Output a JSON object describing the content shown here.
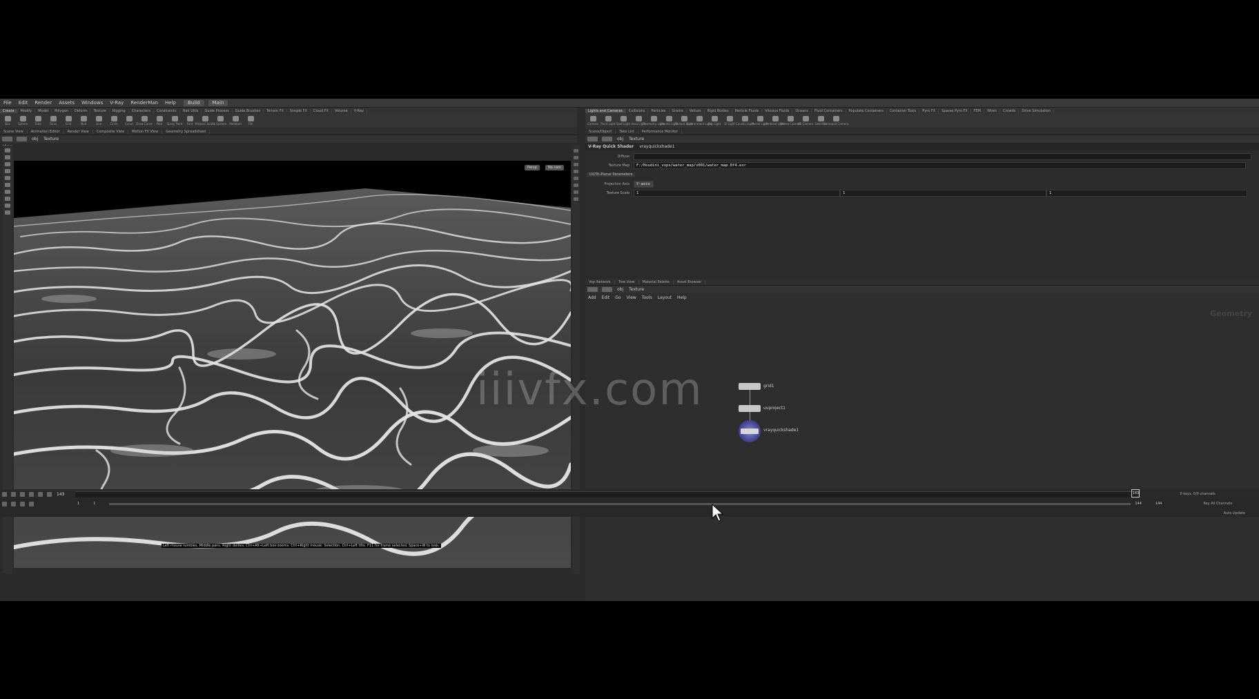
{
  "menu": {
    "items": [
      "File",
      "Edit",
      "Render",
      "Assets",
      "Windows",
      "V-Ray",
      "RenderMan",
      "Help"
    ],
    "desktop": "Build",
    "context": "Main"
  },
  "shelf_left": {
    "tabs": [
      "Create",
      "Modify",
      "Model",
      "Polygon",
      "Deform",
      "Texture",
      "Rigging",
      "Characters",
      "Constraints",
      "Hair Utils",
      "Guide Process",
      "Guide Brushes",
      "Terrain FX",
      "Simple FX",
      "Cloud FX",
      "Volume",
      "V-Ray"
    ],
    "tools": [
      "Box",
      "Sphere",
      "Tube",
      "Torus",
      "Grid",
      "Null",
      "Line",
      "Circle",
      "Curve",
      "Draw Curve",
      "Path",
      "Spray Paint",
      "Font",
      "Platonic Solids",
      "L-System",
      "Metaball",
      "File"
    ]
  },
  "shelf_right": {
    "tabs": [
      "Lights and Cameras",
      "Collisions",
      "Particles",
      "Grains",
      "Vellum",
      "Rigid Bodies",
      "Particle Fluids",
      "Viscous Fluids",
      "Oceans",
      "Fluid Containers",
      "Populate Containers",
      "Container Tools",
      "Pyro FX",
      "Sparse Pyro FX",
      "FEM",
      "Wires",
      "Crowds",
      "Drive Simulation"
    ],
    "tools": [
      "Camera",
      "Point Light",
      "Spot Light",
      "Area Light",
      "Geometry Light",
      "Volume Light",
      "Distant Light",
      "Environment Light",
      "Sky Light",
      "GI Light",
      "Caustic Light",
      "Portal Light",
      "Ambient Light",
      "Stereo Camera",
      "VR Camera",
      "Switcher",
      "Gamepad Camera"
    ]
  },
  "left_pane": {
    "tabs": [
      "Scene View",
      "Animation Editor",
      "Render View",
      "Composite View",
      "Motion FX View",
      "Geometry Spreadsheet"
    ],
    "path": "obj",
    "node": "Texture",
    "view_label": "View",
    "persp": "Persp",
    "cam": "No cam",
    "status": "Left mouse tumbles. Middle pans. Right dollies. Ctrl+Alt+Left box-zooms. Ctrl+Right mouse: Selection. Ctrl+Left tilts. F11 for frame selected. Space+W to look."
  },
  "param_pane": {
    "tabs": [
      "Scene/Object",
      "Take List",
      "Performance Monitor"
    ],
    "path": "obj",
    "node": "Texture",
    "type_label": "V-Ray Quick Shader",
    "node_name": "vrayquickshade1",
    "params": {
      "color_label": "Diffuse",
      "texture_label": "Texture Map",
      "texture_value": "F:/Houdini_vops/water_map/v001/water_map.0f4.exr",
      "folder": "UV/Tri-Planar Parameters",
      "proj_label": "Projection Axis",
      "proj_value": "Y-axis",
      "scale_label": "Texture Scale",
      "scale_values": [
        "1",
        "1",
        "1"
      ]
    }
  },
  "network_pane": {
    "tabs": [
      "Vop Network",
      "Tree View",
      "Material Palette",
      "Asset Browser"
    ],
    "path": "obj",
    "node": "Texture",
    "menu": [
      "Add",
      "Edit",
      "Go",
      "View",
      "Tools",
      "Layout",
      "Help"
    ],
    "context_label": "Geometry",
    "nodes": [
      {
        "name": "grid1",
        "label": "grid1"
      },
      {
        "name": "uvproject1",
        "label": "uvproject1"
      },
      {
        "name": "vrayquickshade1",
        "label": "vrayquickshade1"
      }
    ]
  },
  "timeline": {
    "current_frame": "143",
    "start": "1",
    "start2": "1",
    "end": "144",
    "end2": "144",
    "marker": "143",
    "key_label": "0 keys, 0/0 channels",
    "channels_label": "Key All Channels",
    "auto_update": "Auto Update"
  },
  "watermark": "iiivfx.com"
}
